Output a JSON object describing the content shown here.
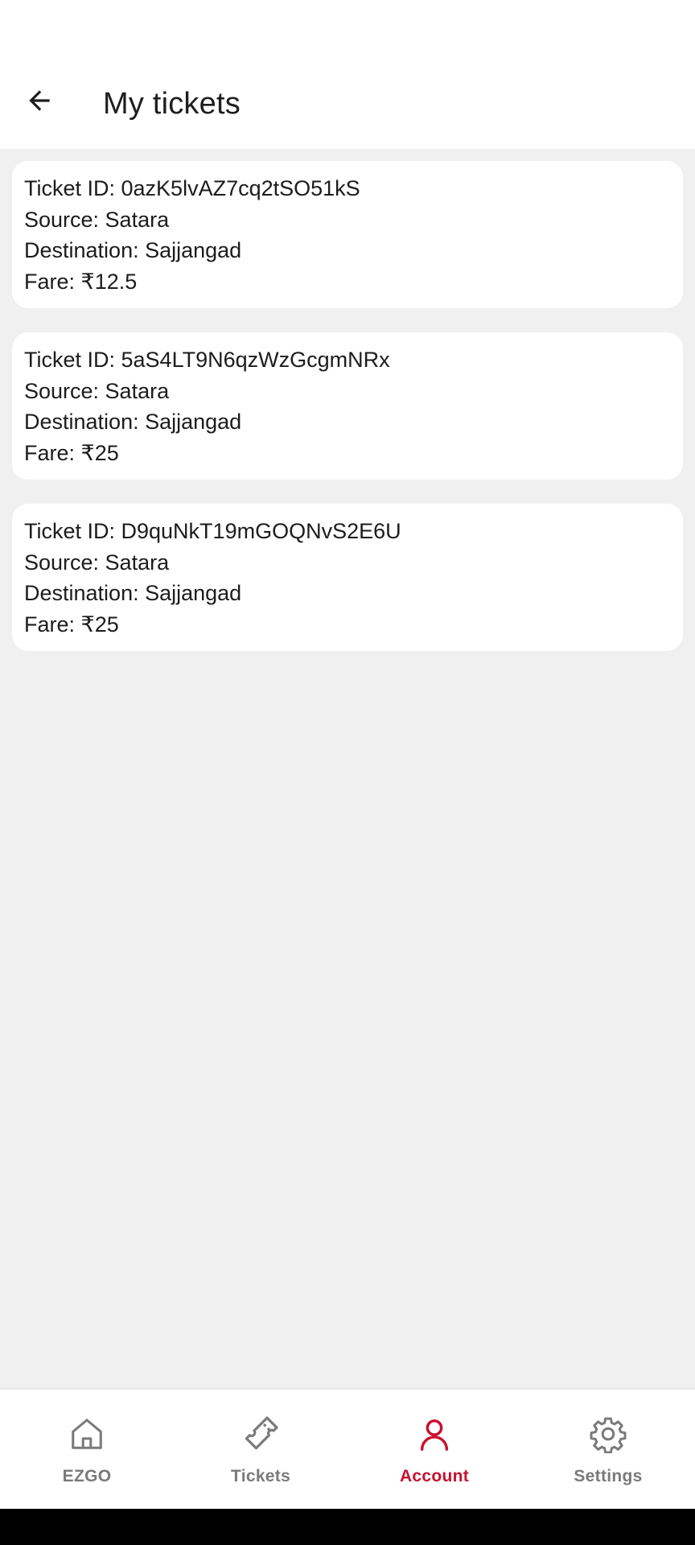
{
  "header": {
    "title": "My tickets",
    "back_icon": "arrow-left-icon"
  },
  "tickets": [
    {
      "id_text": "Ticket ID: 0azK5lvAZ7cq2tSO51kS",
      "source_text": "Source: Satara",
      "destination_text": "Destination: Sajjangad",
      "fare_text": "Fare: ₹12.5"
    },
    {
      "id_text": "Ticket ID: 5aS4LT9N6qzWzGcgmNRx",
      "source_text": "Source: Satara",
      "destination_text": "Destination: Sajjangad",
      "fare_text": "Fare: ₹25"
    },
    {
      "id_text": "Ticket ID: D9quNkT19mGOQNvS2E6U",
      "source_text": "Source: Satara",
      "destination_text": "Destination: Sajjangad",
      "fare_text": "Fare: ₹25"
    }
  ],
  "bottom_nav": {
    "items": [
      {
        "label": "EZGO",
        "icon": "home-icon",
        "active": false
      },
      {
        "label": "Tickets",
        "icon": "ticket-icon",
        "active": false
      },
      {
        "label": "Account",
        "icon": "person-icon",
        "active": true
      },
      {
        "label": "Settings",
        "icon": "gear-icon",
        "active": false
      }
    ]
  },
  "colors": {
    "accent": "#c8102e",
    "inactive": "#7a7a7a",
    "background": "#f0f0f0",
    "card": "#ffffff"
  }
}
